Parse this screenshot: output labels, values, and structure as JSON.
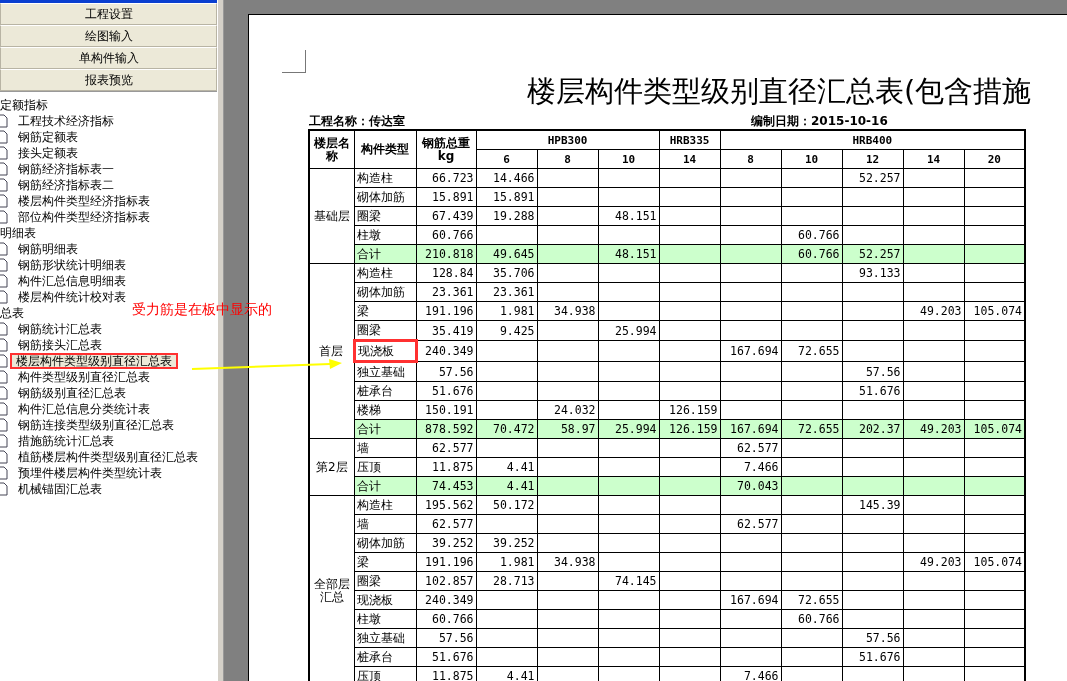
{
  "nav_buttons": [
    "工程设置",
    "绘图输入",
    "单构件输入",
    "报表预览"
  ],
  "sidebar": {
    "tree": [
      {
        "label": "定额指标",
        "children": [
          {
            "label": "工程技术经济指标",
            "selected": false,
            "highlighted": false
          },
          {
            "label": "钢筋定额表",
            "selected": false,
            "highlighted": false
          },
          {
            "label": "接头定额表",
            "selected": false,
            "highlighted": false
          },
          {
            "label": "钢筋经济指标表一",
            "selected": false,
            "highlighted": false
          },
          {
            "label": "钢筋经济指标表二",
            "selected": false,
            "highlighted": false
          },
          {
            "label": "楼层构件类型经济指标表",
            "selected": false,
            "highlighted": false
          },
          {
            "label": "部位构件类型经济指标表",
            "selected": false,
            "highlighted": false
          }
        ]
      },
      {
        "label": "明细表",
        "children": [
          {
            "label": "钢筋明细表",
            "selected": false,
            "highlighted": false
          },
          {
            "label": "钢筋形状统计明细表",
            "selected": false,
            "highlighted": false
          },
          {
            "label": "构件汇总信息明细表",
            "selected": false,
            "highlighted": false
          },
          {
            "label": "楼层构件统计校对表",
            "selected": false,
            "highlighted": false
          }
        ]
      },
      {
        "label": "总表",
        "children": [
          {
            "label": "钢筋统计汇总表",
            "selected": false,
            "highlighted": false
          },
          {
            "label": "钢筋接头汇总表",
            "selected": false,
            "highlighted": false
          },
          {
            "label": "楼层构件类型级别直径汇总表",
            "selected": true,
            "highlighted": true
          },
          {
            "label": "构件类型级别直径汇总表",
            "selected": false,
            "highlighted": false
          },
          {
            "label": "钢筋级别直径汇总表",
            "selected": false,
            "highlighted": false
          },
          {
            "label": "构件汇总信息分类统计表",
            "selected": false,
            "highlighted": false
          },
          {
            "label": "钢筋连接类型级别直径汇总表",
            "selected": false,
            "highlighted": false
          },
          {
            "label": "措施筋统计汇总表",
            "selected": false,
            "highlighted": false
          },
          {
            "label": "植筋楼层构件类型级别直径汇总表",
            "selected": false,
            "highlighted": false
          },
          {
            "label": "预埋件楼层构件类型统计表",
            "selected": false,
            "highlighted": false
          },
          {
            "label": "机械锚固汇总表",
            "selected": false,
            "highlighted": false
          }
        ]
      }
    ]
  },
  "annotation": {
    "text": "受力筋是在板中显示的"
  },
  "report": {
    "title": "楼层构件类型级别直径汇总表(包含措施",
    "project": "工程名称：传达室",
    "date": "编制日期：2015-10-16",
    "header": {
      "floor": "楼层名称",
      "type": "构件类型",
      "total": "钢筋总重kg",
      "grades": [
        {
          "name": "HPB300",
          "diameters": {
            "hpb300_6": "6",
            "hpb300_8": "8",
            "hpb300_10": "10"
          }
        },
        {
          "name": "HRB335",
          "diameters": {
            "hrb335_14": "14"
          }
        },
        {
          "name": "HRB400",
          "diameters": {
            "hrb400_8": "8",
            "hrb400_10": "10",
            "hrb400_12": "12",
            "hrb400_14": "14",
            "hrb400_20": "20"
          }
        }
      ]
    },
    "groups": [
      {
        "floor": "基础层",
        "rows": [
          {
            "kind": "item",
            "highlighted": false,
            "type": "构造柱",
            "total": "66.723",
            "weights": {
              "hpb300_6": "14.466",
              "hrb400_12": "52.257"
            }
          },
          {
            "kind": "item",
            "highlighted": false,
            "type": "砌体加筋",
            "total": "15.891",
            "weights": {
              "hpb300_6": "15.891"
            }
          },
          {
            "kind": "item",
            "highlighted": false,
            "type": "圈梁",
            "total": "67.439",
            "weights": {
              "hpb300_6": "19.288",
              "hpb300_10": "48.151"
            }
          },
          {
            "kind": "item",
            "highlighted": false,
            "type": "柱墩",
            "total": "60.766",
            "weights": {
              "hrb400_10": "60.766"
            }
          },
          {
            "kind": "subtotal",
            "highlighted": false,
            "type": "合计",
            "total": "210.818",
            "weights": {
              "hpb300_6": "49.645",
              "hpb300_10": "48.151",
              "hrb400_10": "60.766",
              "hrb400_12": "52.257"
            }
          }
        ]
      },
      {
        "floor": "首层",
        "rows": [
          {
            "kind": "item",
            "highlighted": false,
            "type": "构造柱",
            "total": "128.84",
            "weights": {
              "hpb300_6": "35.706",
              "hrb400_12": "93.133"
            }
          },
          {
            "kind": "item",
            "highlighted": false,
            "type": "砌体加筋",
            "total": "23.361",
            "weights": {
              "hpb300_6": "23.361"
            }
          },
          {
            "kind": "item",
            "highlighted": false,
            "type": "梁",
            "total": "191.196",
            "weights": {
              "hpb300_6": "1.981",
              "hpb300_8": "34.938",
              "hrb400_14": "49.203",
              "hrb400_20": "105.074"
            }
          },
          {
            "kind": "item",
            "highlighted": false,
            "type": "圈梁",
            "total": "35.419",
            "weights": {
              "hpb300_6": "9.425",
              "hpb300_10": "25.994"
            }
          },
          {
            "kind": "item",
            "highlighted": true,
            "type": "现浇板",
            "total": "240.349",
            "weights": {
              "hrb400_8": "167.694",
              "hrb400_10": "72.655"
            }
          },
          {
            "kind": "item",
            "highlighted": false,
            "type": "独立基础",
            "total": "57.56",
            "weights": {
              "hrb400_12": "57.56"
            }
          },
          {
            "kind": "item",
            "highlighted": false,
            "type": "桩承台",
            "total": "51.676",
            "weights": {
              "hrb400_12": "51.676"
            }
          },
          {
            "kind": "item",
            "highlighted": false,
            "type": "楼梯",
            "total": "150.191",
            "weights": {
              "hpb300_8": "24.032",
              "hrb335_14": "126.159"
            }
          },
          {
            "kind": "subtotal",
            "highlighted": false,
            "type": "合计",
            "total": "878.592",
            "weights": {
              "hpb300_6": "70.472",
              "hpb300_8": "58.97",
              "hpb300_10": "25.994",
              "hrb335_14": "126.159",
              "hrb400_8": "167.694",
              "hrb400_10": "72.655",
              "hrb400_12": "202.37",
              "hrb400_14": "49.203",
              "hrb400_20": "105.074"
            }
          }
        ]
      },
      {
        "floor": "第2层",
        "rows": [
          {
            "kind": "item",
            "highlighted": false,
            "type": "墙",
            "total": "62.577",
            "weights": {
              "hrb400_8": "62.577"
            }
          },
          {
            "kind": "item",
            "highlighted": false,
            "type": "压顶",
            "total": "11.875",
            "weights": {
              "hpb300_6": "4.41",
              "hrb400_8": "7.466"
            }
          },
          {
            "kind": "subtotal",
            "highlighted": false,
            "type": "合计",
            "total": "74.453",
            "weights": {
              "hpb300_6": "4.41",
              "hrb400_8": "70.043"
            }
          }
        ]
      },
      {
        "floor": "全部层汇总",
        "rows": [
          {
            "kind": "item",
            "highlighted": false,
            "type": "构造柱",
            "total": "195.562",
            "weights": {
              "hpb300_6": "50.172",
              "hrb400_12": "145.39"
            }
          },
          {
            "kind": "item",
            "highlighted": false,
            "type": "墙",
            "total": "62.577",
            "weights": {
              "hrb400_8": "62.577"
            }
          },
          {
            "kind": "item",
            "highlighted": false,
            "type": "砌体加筋",
            "total": "39.252",
            "weights": {
              "hpb300_6": "39.252"
            }
          },
          {
            "kind": "item",
            "highlighted": false,
            "type": "梁",
            "total": "191.196",
            "weights": {
              "hpb300_6": "1.981",
              "hpb300_8": "34.938",
              "hrb400_14": "49.203",
              "hrb400_20": "105.074"
            }
          },
          {
            "kind": "item",
            "highlighted": false,
            "type": "圈梁",
            "total": "102.857",
            "weights": {
              "hpb300_6": "28.713",
              "hpb300_10": "74.145"
            }
          },
          {
            "kind": "item",
            "highlighted": false,
            "type": "现浇板",
            "total": "240.349",
            "weights": {
              "hrb400_8": "167.694",
              "hrb400_10": "72.655"
            }
          },
          {
            "kind": "item",
            "highlighted": false,
            "type": "柱墩",
            "total": "60.766",
            "weights": {
              "hrb400_10": "60.766"
            }
          },
          {
            "kind": "item",
            "highlighted": false,
            "type": "独立基础",
            "total": "57.56",
            "weights": {
              "hrb400_12": "57.56"
            }
          },
          {
            "kind": "item",
            "highlighted": false,
            "type": "桩承台",
            "total": "51.676",
            "weights": {
              "hrb400_12": "51.676"
            }
          },
          {
            "kind": "item",
            "highlighted": false,
            "type": "压顶",
            "total": "11.875",
            "weights": {
              "hpb300_6": "4.41",
              "hrb400_8": "7.466"
            }
          }
        ]
      }
    ]
  }
}
